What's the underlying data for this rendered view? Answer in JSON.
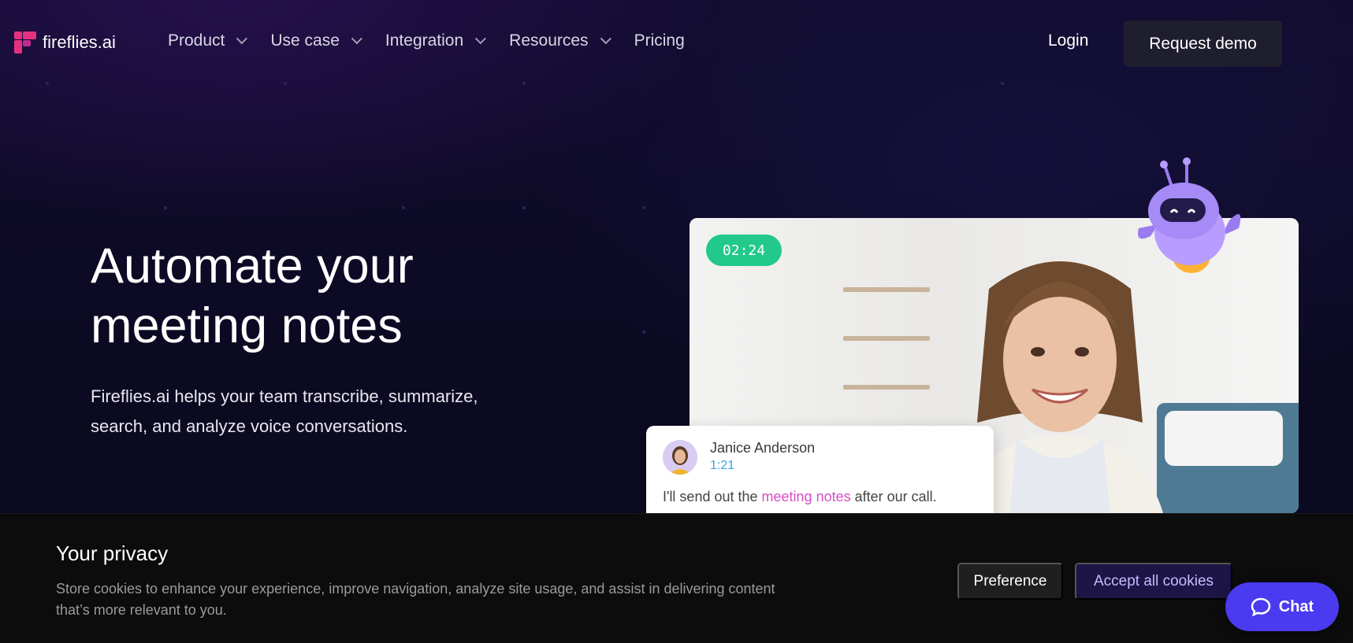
{
  "brand": {
    "name": "fireflies.ai",
    "accent": "#e4317f"
  },
  "nav": {
    "items": [
      {
        "label": "Product",
        "has_dropdown": true
      },
      {
        "label": "Use case",
        "has_dropdown": true
      },
      {
        "label": "Integration",
        "has_dropdown": true
      },
      {
        "label": "Resources",
        "has_dropdown": true
      },
      {
        "label": "Pricing",
        "has_dropdown": false
      }
    ],
    "login_label": "Login",
    "demo_label": "Request demo"
  },
  "hero": {
    "headline_line1": "Automate your",
    "headline_line2": "meeting notes",
    "subhead_line1": "Fireflies.ai helps your team transcribe, summarize,",
    "subhead_line2": "search, and analyze voice conversations."
  },
  "video": {
    "timer": "02:24",
    "timer_color": "#22c98a"
  },
  "quote": {
    "name": "Janice Anderson",
    "time": "1:21",
    "text_before": "I'll send out the ",
    "text_highlight": "meeting notes",
    "text_after": " after our call.",
    "highlight_color": "#d44fc4"
  },
  "cookie": {
    "title": "Your privacy",
    "text": "Store cookies to enhance your experience, improve navigation, analyze site usage, and assist in delivering content that’s more relevant to you.",
    "preference_label": "Preference",
    "accept_label": "Accept all cookies"
  },
  "chat": {
    "label": "Chat",
    "color": "#4a3af0"
  }
}
